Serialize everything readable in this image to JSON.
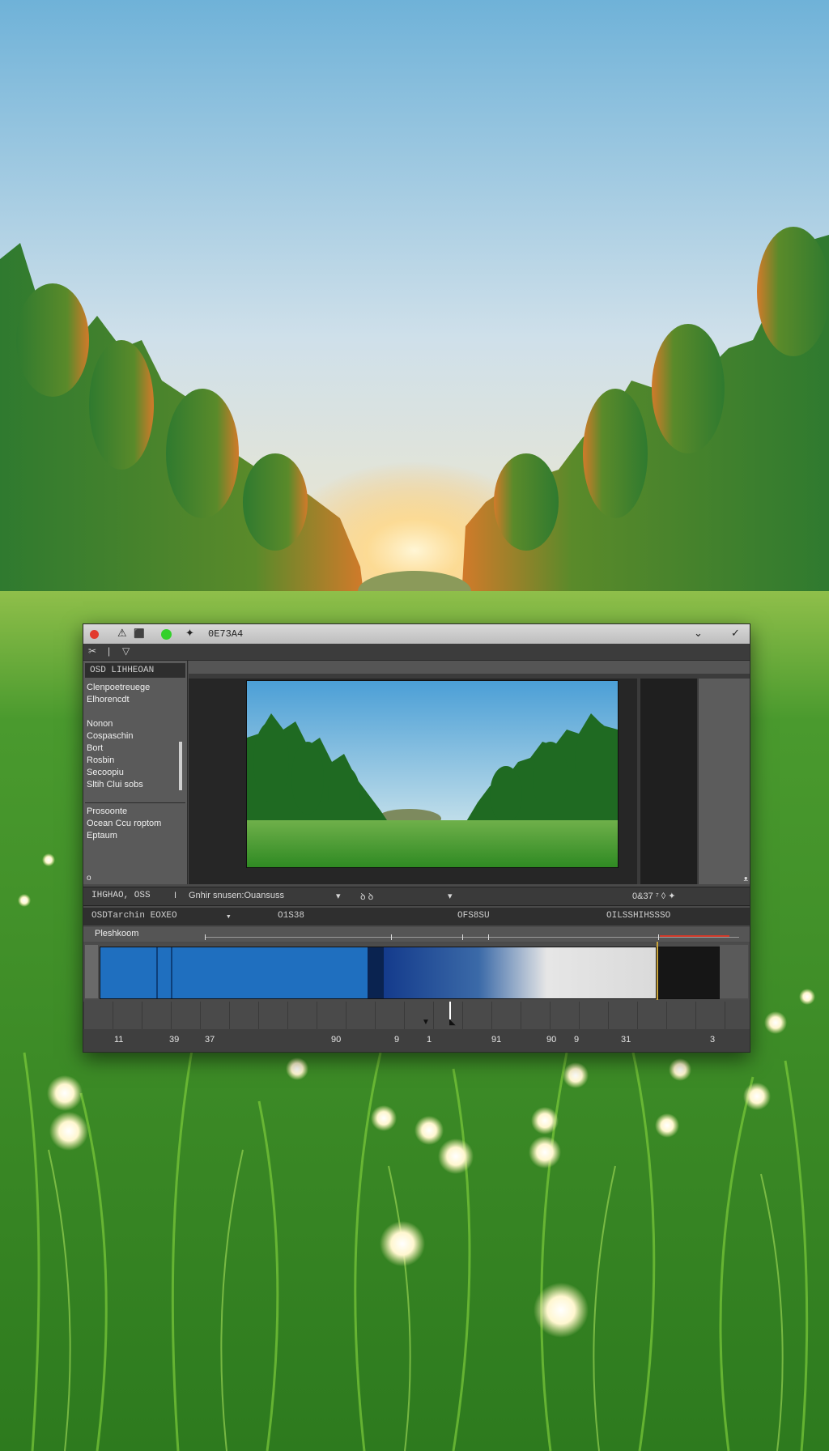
{
  "colors": {
    "sky_top": "#6fb2d8",
    "sky_bottom": "#dbe6ec",
    "sun_glow": "#ffd98a",
    "grass": "#3d8f2a",
    "window_bg": "#4a4a4a",
    "clip_blue": "#1f6fbf",
    "clip_navy": "#143b8c",
    "playhead_red": "#d23a2a",
    "traffic_red": "#e23b2e",
    "traffic_green": "#33d12b"
  },
  "window": {
    "title": "0E73A4",
    "toolbar_tools": [
      "✂",
      "|",
      "▽"
    ],
    "titlebar_icons": [
      "⚠",
      "⬛",
      "✦"
    ],
    "titlebar_right": [
      "⌄",
      "✓"
    ]
  },
  "side_panel": {
    "header": "OSD LIHHEOAN",
    "items": [
      "Clenpoetreuege",
      "Elhorencdt",
      "",
      "Nonon",
      "Cospaschin",
      "Bort",
      "Rosbin",
      "Secoopiu",
      "Sltih Clui sobs"
    ],
    "items_lower": [
      "Prosoonte",
      "Ocean Ccu roptom",
      "Eptaum"
    ],
    "corner": "o"
  },
  "statusbar": {
    "left": "IHGHAO, OSS",
    "sep": "I",
    "middle": "Gnhir snusen:Ouansuss",
    "dropdown": "▾",
    "icons": "ꝺ ꝺ",
    "dropdown2": "▾",
    "right": "0&37 ⁷ ◊ ✦"
  },
  "timeline_header": {
    "left": "OSDTarchin EOXEO",
    "caret": "▾",
    "tc1": "O1S38",
    "tc2": "OFS8SU",
    "tc3": "OILSSHIHSSSO"
  },
  "track": {
    "label": "Pleshkoom"
  },
  "bottom_numbers": [
    "11",
    "39",
    "37",
    "90",
    "9",
    "1",
    "91",
    "90",
    "9",
    "31",
    "3"
  ],
  "viewer": {
    "corner_mark": "ᴥ"
  }
}
